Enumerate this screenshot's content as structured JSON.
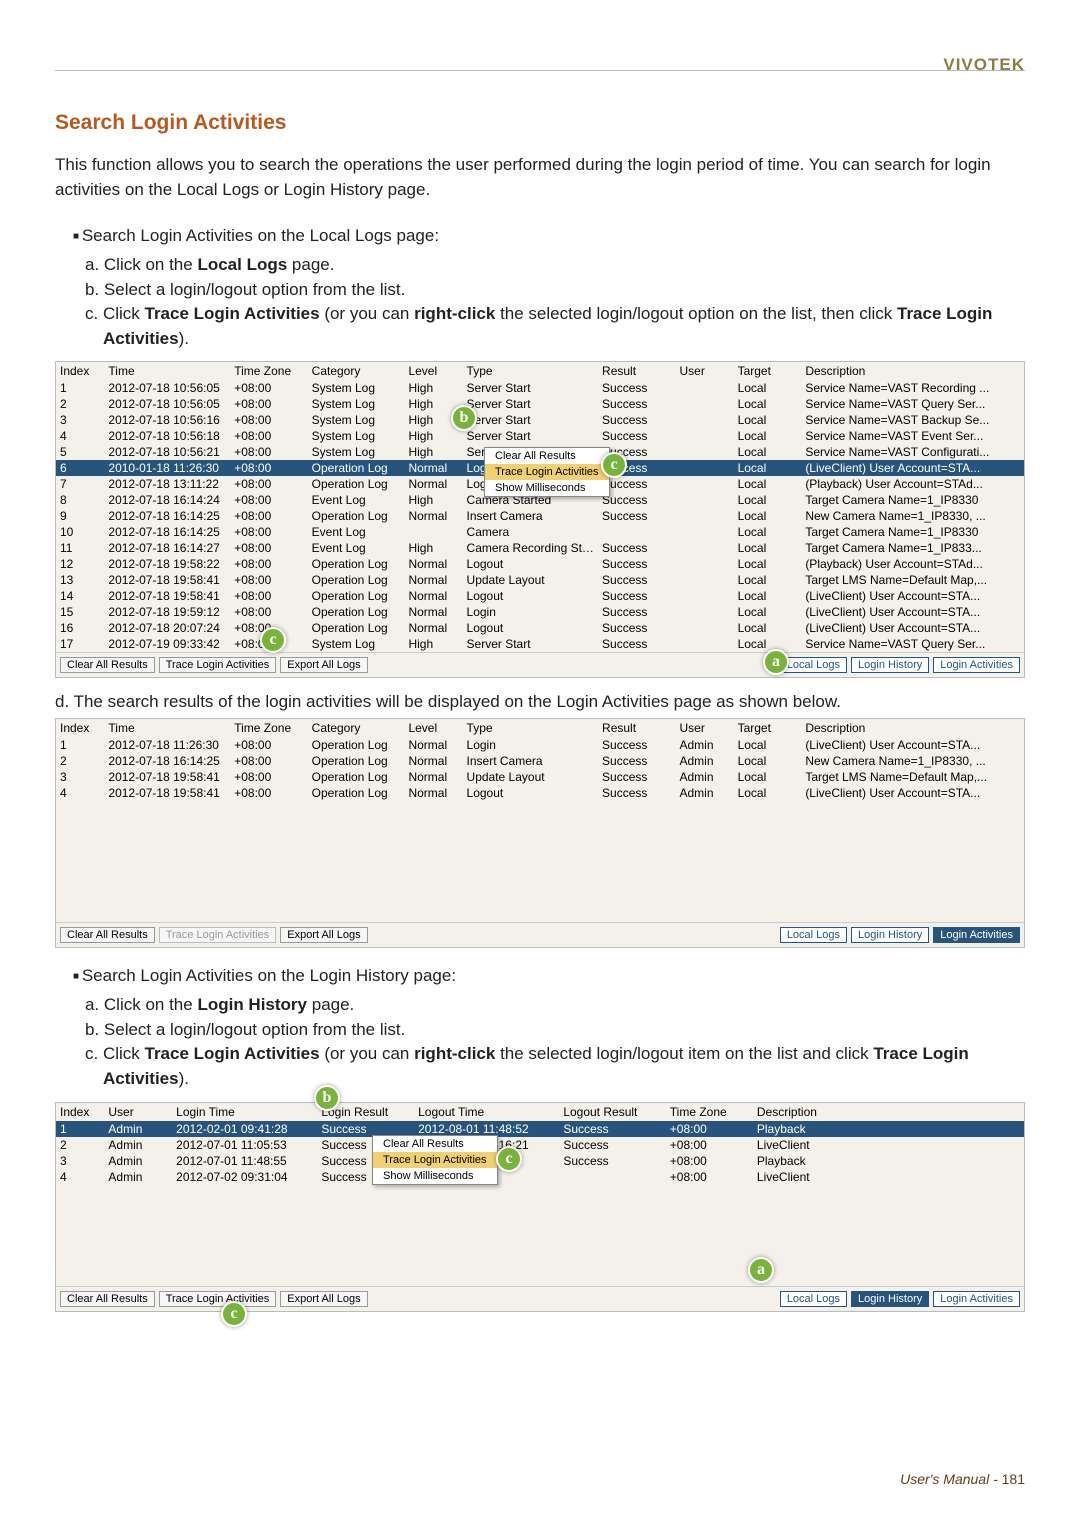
{
  "brand": "VIVOTEK",
  "section_title": "Search Login Activities",
  "intro": "This function allows you to search the operations the user performed during the login period of time. You can search for login activities on the Local Logs or Login History page.",
  "procA": {
    "head": "Search Login Activities on the Local Logs page:",
    "a": "a. Click on the ",
    "a_bold": "Local Logs",
    "a2": " page.",
    "b": "b. Select a login/logout option from the list.",
    "c1": "c. Click ",
    "c_b1": "Trace Login Activities",
    "c2": " (or you can ",
    "c_b2": "right-click",
    "c3": " the selected login/logout option on the list, then click ",
    "c_b3": "Trace Login Activities",
    "c4": ")."
  },
  "note_d": "d. The search results of the login activities will be displayed on the Login Activities page as shown below.",
  "procB": {
    "head": "Search Login Activities on the Login History page:",
    "a": "a. Click on the ",
    "a_bold": "Login History",
    "a2": " page.",
    "b": "b. Select a login/logout option from the list.",
    "c1": "c. Click ",
    "c_b1": "Trace Login Activities",
    "c2": " (or you can ",
    "c_b2": "right-click",
    "c3": " the selected login/logout item on the list and click ",
    "c_b3": "Trace Login Activities",
    "c4": ")."
  },
  "cols_logs": [
    "Index",
    "Time",
    "Time Zone",
    "Category",
    "Level",
    "Type",
    "Result",
    "User",
    "Target",
    "Description"
  ],
  "rows_ss1": [
    [
      "1",
      "2012-07-18 10:56:05",
      "+08:00",
      "System Log",
      "High",
      "Server Start",
      "Success",
      "",
      "Local",
      "Service Name=VAST Recording ..."
    ],
    [
      "2",
      "2012-07-18 10:56:05",
      "+08:00",
      "System Log",
      "High",
      "Server Start",
      "Success",
      "",
      "Local",
      "Service Name=VAST Query Ser..."
    ],
    [
      "3",
      "2012-07-18 10:56:16",
      "+08:00",
      "System Log",
      "High",
      "Server Start",
      "Success",
      "",
      "Local",
      "Service Name=VAST Backup Se..."
    ],
    [
      "4",
      "2012-07-18 10:56:18",
      "+08:00",
      "System Log",
      "High",
      "Server Start",
      "Success",
      "",
      "Local",
      "Service Name=VAST Event Ser..."
    ],
    [
      "5",
      "2012-07-18 10:56:21",
      "+08:00",
      "System Log",
      "High",
      "Server Start",
      "Success",
      "",
      "Local",
      "Service Name=VAST Configurati..."
    ],
    [
      "6",
      "2010-01-18 11:26:30",
      "+08:00",
      "Operation Log",
      "Normal",
      "Login",
      "Success",
      "",
      "Local",
      "(LiveClient) User Account=STA..."
    ],
    [
      "7",
      "2012-07-18 13:11:22",
      "+08:00",
      "Operation Log",
      "Normal",
      "Logout",
      "Success",
      "",
      "Local",
      "(Playback) User Account=STAd..."
    ],
    [
      "8",
      "2012-07-18 16:14:24",
      "+08:00",
      "Event Log",
      "High",
      "Camera Started",
      "Success",
      "",
      "Local",
      "Target Camera Name=1_IP8330"
    ],
    [
      "9",
      "2012-07-18 16:14:25",
      "+08:00",
      "Operation Log",
      "Normal",
      "Insert Camera",
      "Success",
      "",
      "Local",
      "New Camera Name=1_IP8330, ..."
    ],
    [
      "10",
      "2012-07-18 16:14:25",
      "+08:00",
      "Event Log",
      "",
      "Camera",
      "",
      "",
      "Local",
      "Target Camera Name=1_IP8330"
    ],
    [
      "11",
      "2012-07-18 16:14:27",
      "+08:00",
      "Event Log",
      "High",
      "Camera Recording Start",
      "Success",
      "",
      "Local",
      "Target Camera Name=1_IP833..."
    ],
    [
      "12",
      "2012-07-18 19:58:22",
      "+08:00",
      "Operation Log",
      "Normal",
      "Logout",
      "Success",
      "",
      "Local",
      "(Playback) User Account=STAd..."
    ],
    [
      "13",
      "2012-07-18 19:58:41",
      "+08:00",
      "Operation Log",
      "Normal",
      "Update Layout",
      "Success",
      "",
      "Local",
      "Target LMS Name=Default Map,..."
    ],
    [
      "14",
      "2012-07-18 19:58:41",
      "+08:00",
      "Operation Log",
      "Normal",
      "Logout",
      "Success",
      "",
      "Local",
      "(LiveClient) User Account=STA..."
    ],
    [
      "15",
      "2012-07-18 19:59:12",
      "+08:00",
      "Operation Log",
      "Normal",
      "Login",
      "Success",
      "",
      "Local",
      "(LiveClient) User Account=STA..."
    ],
    [
      "16",
      "2012-07-18 20:07:24",
      "+08:00",
      "Operation Log",
      "Normal",
      "Logout",
      "Success",
      "",
      "Local",
      "(LiveClient) User Account=STA..."
    ],
    [
      "17",
      "2012-07-19 09:33:42",
      "+08:00",
      "System Log",
      "High",
      "Server Start",
      "Success",
      "",
      "Local",
      "Service Name=VAST Query Ser..."
    ]
  ],
  "sel_ss1": 5,
  "rows_ss2": [
    [
      "1",
      "2012-07-18 11:26:30",
      "+08:00",
      "Operation Log",
      "Normal",
      "Login",
      "Success",
      "Admin",
      "Local",
      "(LiveClient) User Account=STA..."
    ],
    [
      "2",
      "2012-07-18 16:14:25",
      "+08:00",
      "Operation Log",
      "Normal",
      "Insert Camera",
      "Success",
      "Admin",
      "Local",
      "New Camera Name=1_IP8330, ..."
    ],
    [
      "3",
      "2012-07-18 19:58:41",
      "+08:00",
      "Operation Log",
      "Normal",
      "Update Layout",
      "Success",
      "Admin",
      "Local",
      "Target LMS Name=Default Map,..."
    ],
    [
      "4",
      "2012-07-18 19:58:41",
      "+08:00",
      "Operation Log",
      "Normal",
      "Logout",
      "Success",
      "Admin",
      "Local",
      "(LiveClient) User Account=STA..."
    ]
  ],
  "cols_hist": [
    "Index",
    "User",
    "Login Time",
    "Login Result",
    "Logout Time",
    "Logout Result",
    "Time Zone",
    "Description"
  ],
  "rows_ss3": [
    [
      "1",
      "Admin",
      "2012-02-01 09:41:28",
      "Success",
      "2012-08-01 11:48:52",
      "Success",
      "+08:00",
      "Playback"
    ],
    [
      "2",
      "Admin",
      "2012-07-01 11:05:53",
      "Success",
      "2012-08-01 11:16:21",
      "Success",
      "+08:00",
      "LiveClient"
    ],
    [
      "3",
      "Admin",
      "2012-07-01 11:48:55",
      "Success",
      "",
      "Success",
      "+08:00",
      "Playback"
    ],
    [
      "4",
      "Admin",
      "2012-07-02 09:31:04",
      "Success",
      "",
      "",
      "+08:00",
      "LiveClient"
    ]
  ],
  "sel_ss3": 0,
  "ctx_items": [
    "Clear All Results",
    "Trace Login Activities",
    "Show Milliseconds"
  ],
  "buttons": {
    "clear": "Clear All Results",
    "trace": "Trace Login Activities",
    "export": "Export All Logs"
  },
  "tabs": {
    "local": "Local Logs",
    "history": "Login History",
    "activities": "Login Activities"
  },
  "footer_label": "User's Manual - ",
  "footer_page": "181"
}
